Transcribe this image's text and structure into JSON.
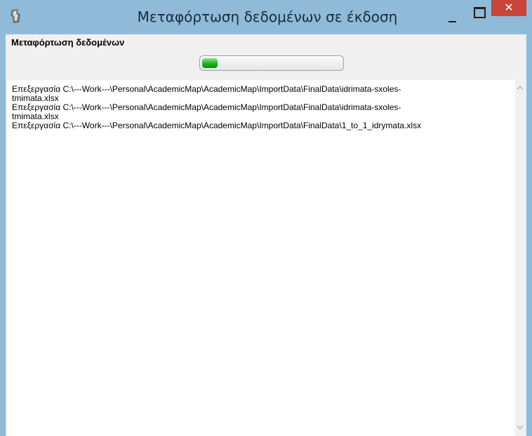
{
  "window": {
    "title": "Μεταφόρτωση δεδομένων σε έκδοση",
    "icon": "app-icon",
    "title_bar_color": "#8fbbd8",
    "close_button_color": "#c9443a",
    "close_glyph": "✕"
  },
  "panel": {
    "label": "Μεταφόρτωση δεδομένων",
    "progress_percent": 11,
    "progress_color": "#1fb51f"
  },
  "log": {
    "lines": [
      "Επεξεργασία C:\\---Work---\\Personal\\AcademicMap\\AcademicMap\\ImportData\\FinalData\\idrimata-sxoles-",
      "tmimata.xlsx",
      "Επεξεργασία C:\\---Work---\\Personal\\AcademicMap\\AcademicMap\\ImportData\\FinalData\\idrimata-sxoles-",
      "tmimata.xlsx",
      "Επεξεργασία C:\\---Work---\\Personal\\AcademicMap\\AcademicMap\\ImportData\\FinalData\\1_to_1_idrymata.xlsx"
    ]
  }
}
